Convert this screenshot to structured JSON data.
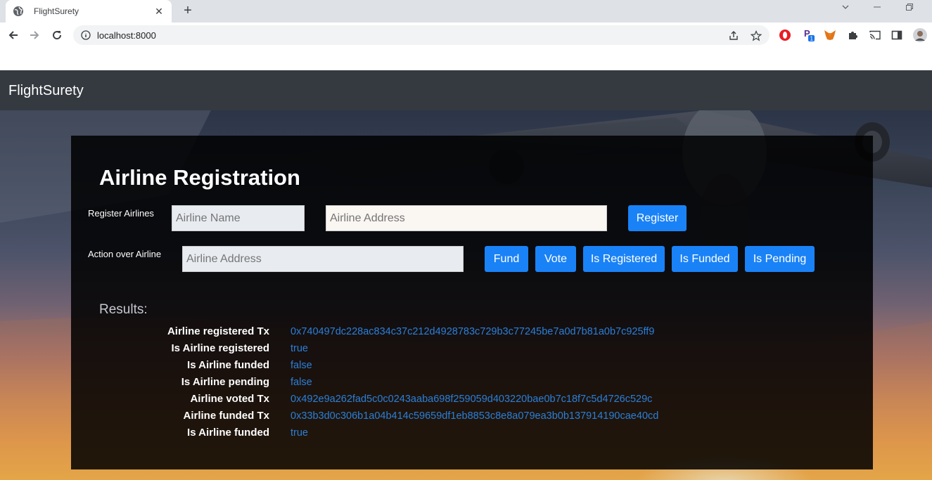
{
  "browser": {
    "tab_title": "FlightSurety",
    "url": "localhost:8000"
  },
  "app": {
    "brand": "FlightSurety",
    "accent_color": "#1a82f7",
    "navbar_color": "#343a40"
  },
  "registration": {
    "heading": "Airline Registration",
    "register_label": "Register Airlines",
    "airline_name_placeholder": "Airline Name",
    "airline_address_placeholder": "Airline Address",
    "register_button": "Register",
    "action_label": "Action over Airline",
    "action_address_placeholder": "Airline Address",
    "buttons": {
      "fund": "Fund",
      "vote": "Vote",
      "is_registered": "Is Registered",
      "is_funded": "Is Funded",
      "is_pending": "Is Pending"
    }
  },
  "results": {
    "title": "Results:",
    "rows": [
      {
        "label": "Airline registered Tx",
        "value": "0x740497dc228ac834c37c212d4928783c729b3c77245be7a0d7b81a0b7c925ff9"
      },
      {
        "label": "Is Airline registered",
        "value": "true"
      },
      {
        "label": "Is Airline funded",
        "value": "false"
      },
      {
        "label": "Is Airline pending",
        "value": "false"
      },
      {
        "label": "Airline voted Tx",
        "value": "0x492e9a262fad5c0c0243aaba698f259059d403220bae0b7c18f7c5d4726c529c"
      },
      {
        "label": "Airline funded Tx",
        "value": "0x33b3d0c306b1a04b414c59659df1eb8853c8e8a079ea3b0b137914190cae40cd"
      },
      {
        "label": "Is Airline funded",
        "value": "true"
      }
    ]
  }
}
